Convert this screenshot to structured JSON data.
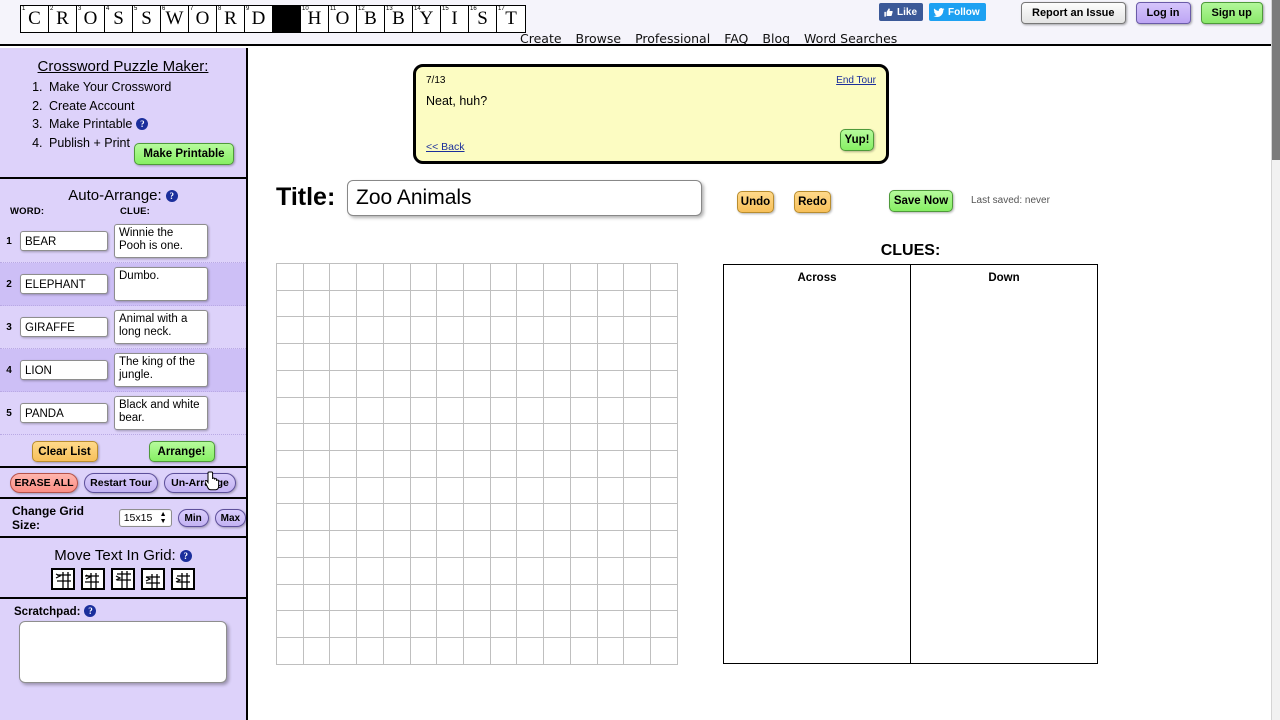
{
  "logo": {
    "letters": [
      "C",
      "R",
      "O",
      "S",
      "S",
      "W",
      "O",
      "R",
      "D",
      "",
      "H",
      "O",
      "B",
      "B",
      "Y",
      "I",
      "S",
      "T"
    ],
    "numbers": [
      "1",
      "2",
      "3",
      "4",
      "5",
      "6",
      "7",
      "8",
      "9",
      "",
      "10",
      "11",
      "12",
      "13",
      "14",
      "15",
      "16",
      "17"
    ]
  },
  "social": [
    {
      "name": "facebook-like-button",
      "label": "Like"
    },
    {
      "name": "twitter-follow-button",
      "label": "Follow"
    }
  ],
  "account": {
    "report_label": "Report an Issue",
    "login_label": "Log in",
    "signup_label": "Sign up"
  },
  "nav": [
    "Create",
    "Browse",
    "Professional",
    "FAQ",
    "Blog",
    "Word Searches"
  ],
  "sidebar": {
    "maker": {
      "title": "Crossword Puzzle Maker:",
      "steps": [
        "Make Your Crossword",
        "Create Account",
        "Make Printable",
        "Publish + Print"
      ],
      "make_printable_label": "Make Printable"
    },
    "auto_arrange": {
      "title": "Auto-Arrange:",
      "word_header": "WORD:",
      "clue_header": "CLUE:",
      "rows": [
        {
          "index": "1",
          "word": "BEAR",
          "clue": "Winnie the Pooh is one."
        },
        {
          "index": "2",
          "word": "ELEPHANT",
          "clue": "Dumbo."
        },
        {
          "index": "3",
          "word": "GIRAFFE",
          "clue": "Animal with a long neck."
        },
        {
          "index": "4",
          "word": "LION",
          "clue": "The king of the jungle."
        },
        {
          "index": "5",
          "word": "PANDA",
          "clue": "Black and white bear."
        }
      ],
      "clear_list_label": "Clear List",
      "arrange_label": "Arrange!"
    },
    "tour_controls": {
      "erase_all_label": "ERASE ALL",
      "restart_tour_label": "Restart Tour",
      "un_arrange_label": "Un-Arrange"
    },
    "grid_size": {
      "label": "Change Grid Size:",
      "selected": "15x15",
      "options": [
        "15x15"
      ],
      "min_label": "Min",
      "max_label": "Max"
    },
    "move_text": {
      "title": "Move Text In Grid:",
      "icons": [
        "move-up-left-icon",
        "move-down-left-icon",
        "move-up-icon",
        "move-down-right-icon",
        "move-right-icon"
      ]
    },
    "scratchpad": {
      "label": "Scratchpad:",
      "value": ""
    }
  },
  "tour": {
    "step": "7/13",
    "end_label": "End Tour",
    "message": "Neat, huh?",
    "back_label": "<< Back",
    "confirm_label": "Yup!"
  },
  "title_row": {
    "label": "Title:",
    "value": "Zoo Animals",
    "undo_label": "Undo",
    "redo_label": "Redo",
    "save_label": "Save Now",
    "last_saved": "Last saved: never"
  },
  "grid": {
    "columns": 15,
    "rows": 15,
    "cells": []
  },
  "clues": {
    "title": "CLUES:",
    "across_header": "Across",
    "down_header": "Down",
    "across_items": [],
    "down_items": []
  },
  "colors": {
    "sidebar_bg": "#ddd2fa",
    "sidebar_alt_row": "#cdbff6",
    "tour_bg": "#fcfcc2",
    "green_button": "#86ef63",
    "orange_button": "#f7c05a",
    "facebook_blue": "#3b5998",
    "twitter_blue": "#1da1f2",
    "grid_line": "#bfbfbf"
  }
}
